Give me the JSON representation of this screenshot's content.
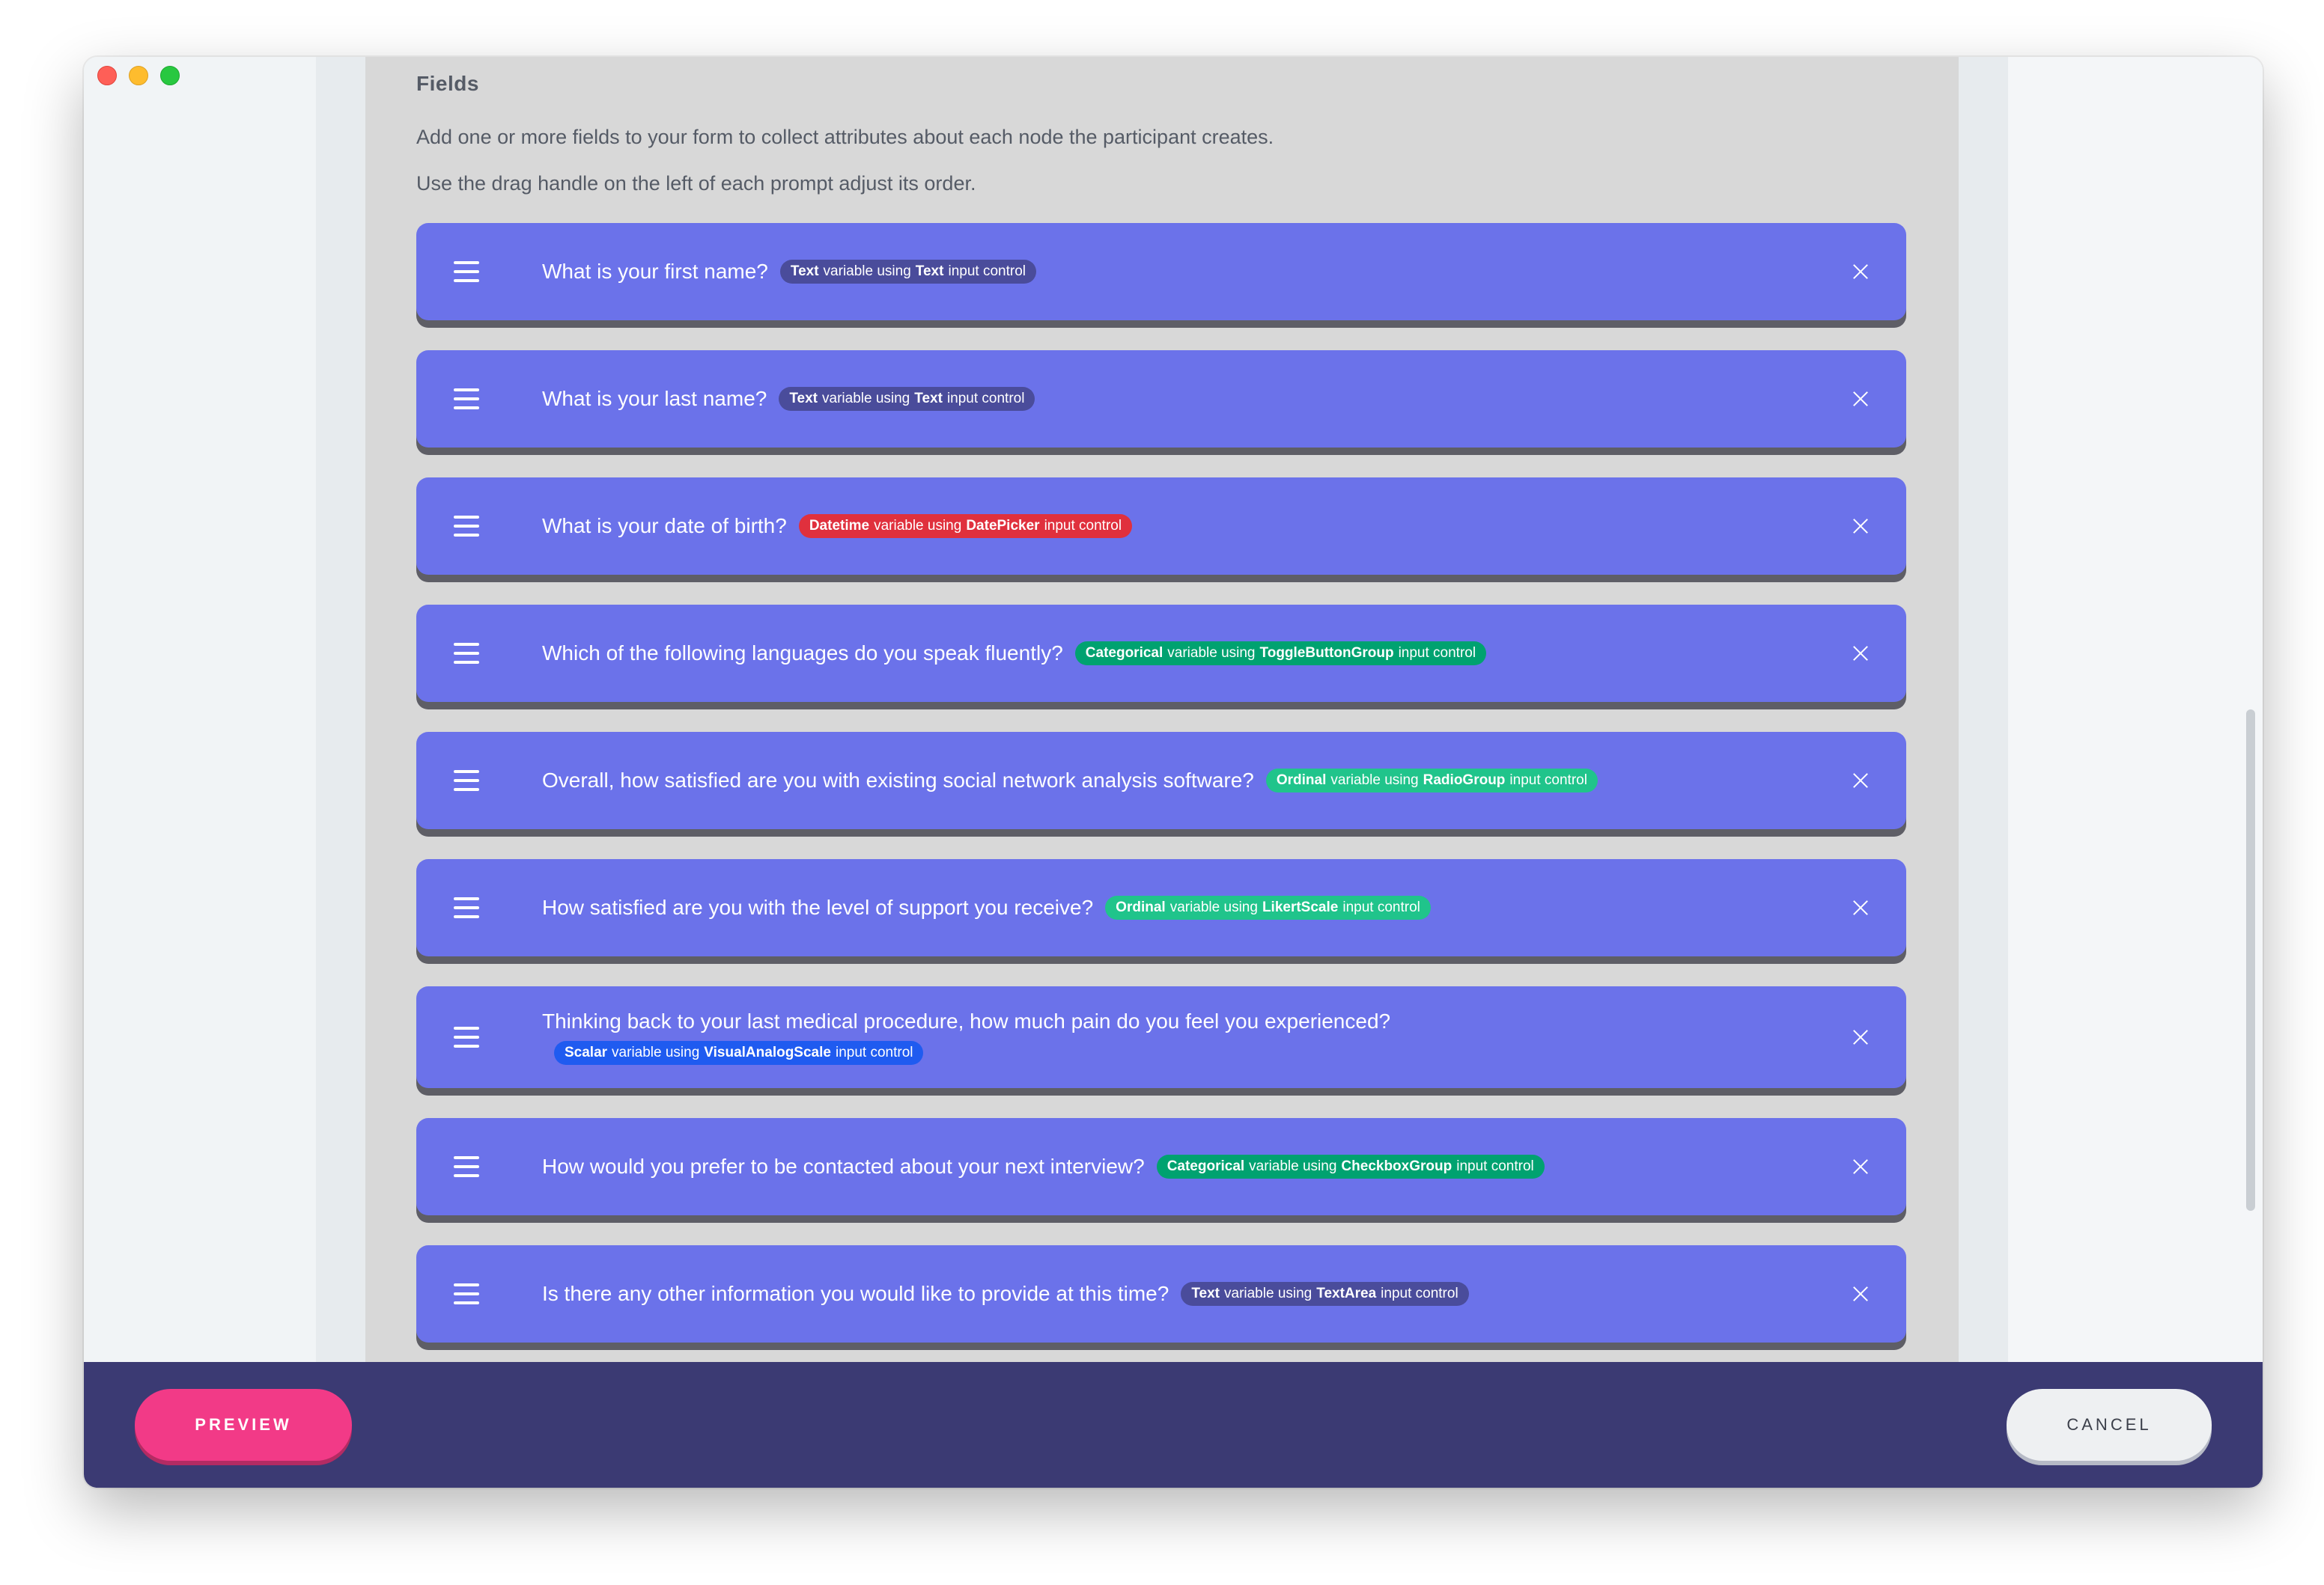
{
  "section": {
    "title": "Fields",
    "description_1": "Add one or more fields to your form to collect attributes about each node the participant creates.",
    "description_2": "Use the drag handle on the left of each prompt adjust its order."
  },
  "fields": [
    {
      "prompt": "What is your first name?",
      "variable_type": "Text",
      "control": "Text",
      "badge_style": "text",
      "badge_color": "#4a4c9b"
    },
    {
      "prompt": "What is your last name?",
      "variable_type": "Text",
      "control": "Text",
      "badge_style": "text",
      "badge_color": "#4a4c9b"
    },
    {
      "prompt": "What is your date of birth?",
      "variable_type": "Datetime",
      "control": "DatePicker",
      "badge_style": "datetime",
      "badge_color": "#e0303d"
    },
    {
      "prompt": "Which of the following languages do you speak fluently?",
      "variable_type": "Categorical",
      "control": "ToggleButtonGroup",
      "badge_style": "categorical",
      "badge_color": "#00a270"
    },
    {
      "prompt": "Overall, how satisfied are you with existing social network analysis software?",
      "variable_type": "Ordinal",
      "control": "RadioGroup",
      "badge_style": "ordinal",
      "badge_color": "#20c48b"
    },
    {
      "prompt": "How satisfied are you with the level of support you receive?",
      "variable_type": "Ordinal",
      "control": "LikertScale",
      "badge_style": "ordinal",
      "badge_color": "#20c48b"
    },
    {
      "prompt": "Thinking back to your last medical procedure, how much pain do you feel you experienced?",
      "variable_type": "Scalar",
      "control": "VisualAnalogScale",
      "badge_style": "scalar",
      "badge_color": "#1f5bf0"
    },
    {
      "prompt": "How would you prefer to be contacted about your next interview?",
      "variable_type": "Categorical",
      "control": "CheckboxGroup",
      "badge_style": "categorical",
      "badge_color": "#00a270"
    },
    {
      "prompt": "Is there any other information you would like to provide at this time?",
      "variable_type": "Text",
      "control": "TextArea",
      "badge_style": "text",
      "badge_color": "#4a4c9b"
    }
  ],
  "badge_words": {
    "variable_using": "variable using",
    "input_control": "input control"
  },
  "footer": {
    "preview_label": "PREVIEW",
    "cancel_label": "CANCEL"
  },
  "icons": {
    "drag": "drag-handle-icon",
    "close": "close-icon"
  },
  "colors": {
    "card": "#6b72ea",
    "footer": "#3b3a73",
    "preview": "#f23a87"
  }
}
